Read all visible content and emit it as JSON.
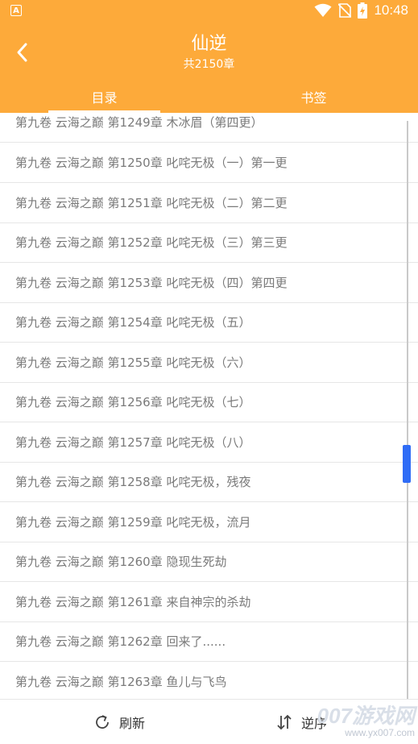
{
  "status": {
    "time": "10:48",
    "app_icon_letter": "A"
  },
  "header": {
    "title": "仙逆",
    "subtitle": "共2150章"
  },
  "tabs": [
    {
      "label": "目录"
    },
    {
      "label": "书签"
    }
  ],
  "chapters": [
    "第九卷 云海之巅 第1249章 木冰眉（第四更）",
    "第九卷 云海之巅 第1250章 叱咤无极（一）第一更",
    "第九卷 云海之巅 第1251章 叱咤无极（二）第二更",
    "第九卷 云海之巅 第1252章 叱咤无极（三）第三更",
    "第九卷 云海之巅 第1253章 叱咤无极（四）第四更",
    "第九卷 云海之巅 第1254章 叱咤无极（五）",
    "第九卷 云海之巅 第1255章 叱咤无极（六）",
    "第九卷 云海之巅 第1256章 叱咤无极（七）",
    "第九卷 云海之巅 第1257章 叱咤无极（八）",
    "第九卷 云海之巅 第1258章 叱咤无极，残夜",
    "第九卷 云海之巅 第1259章 叱咤无极，流月",
    "第九卷 云海之巅 第1260章 隐现生死劫",
    "第九卷 云海之巅 第1261章 来自神宗的杀劫",
    "第九卷 云海之巅 第1262章 回来了......",
    "第九卷 云海之巅 第1263章 鱼儿与飞鸟"
  ],
  "bottom": {
    "refresh_label": "刷新",
    "reverse_label": "逆序"
  },
  "watermark": {
    "text": "007游戏网",
    "url": "www.yx007.com"
  },
  "colors": {
    "accent": "#FDAA3A",
    "scroll_thumb": "#2f6cf6"
  }
}
